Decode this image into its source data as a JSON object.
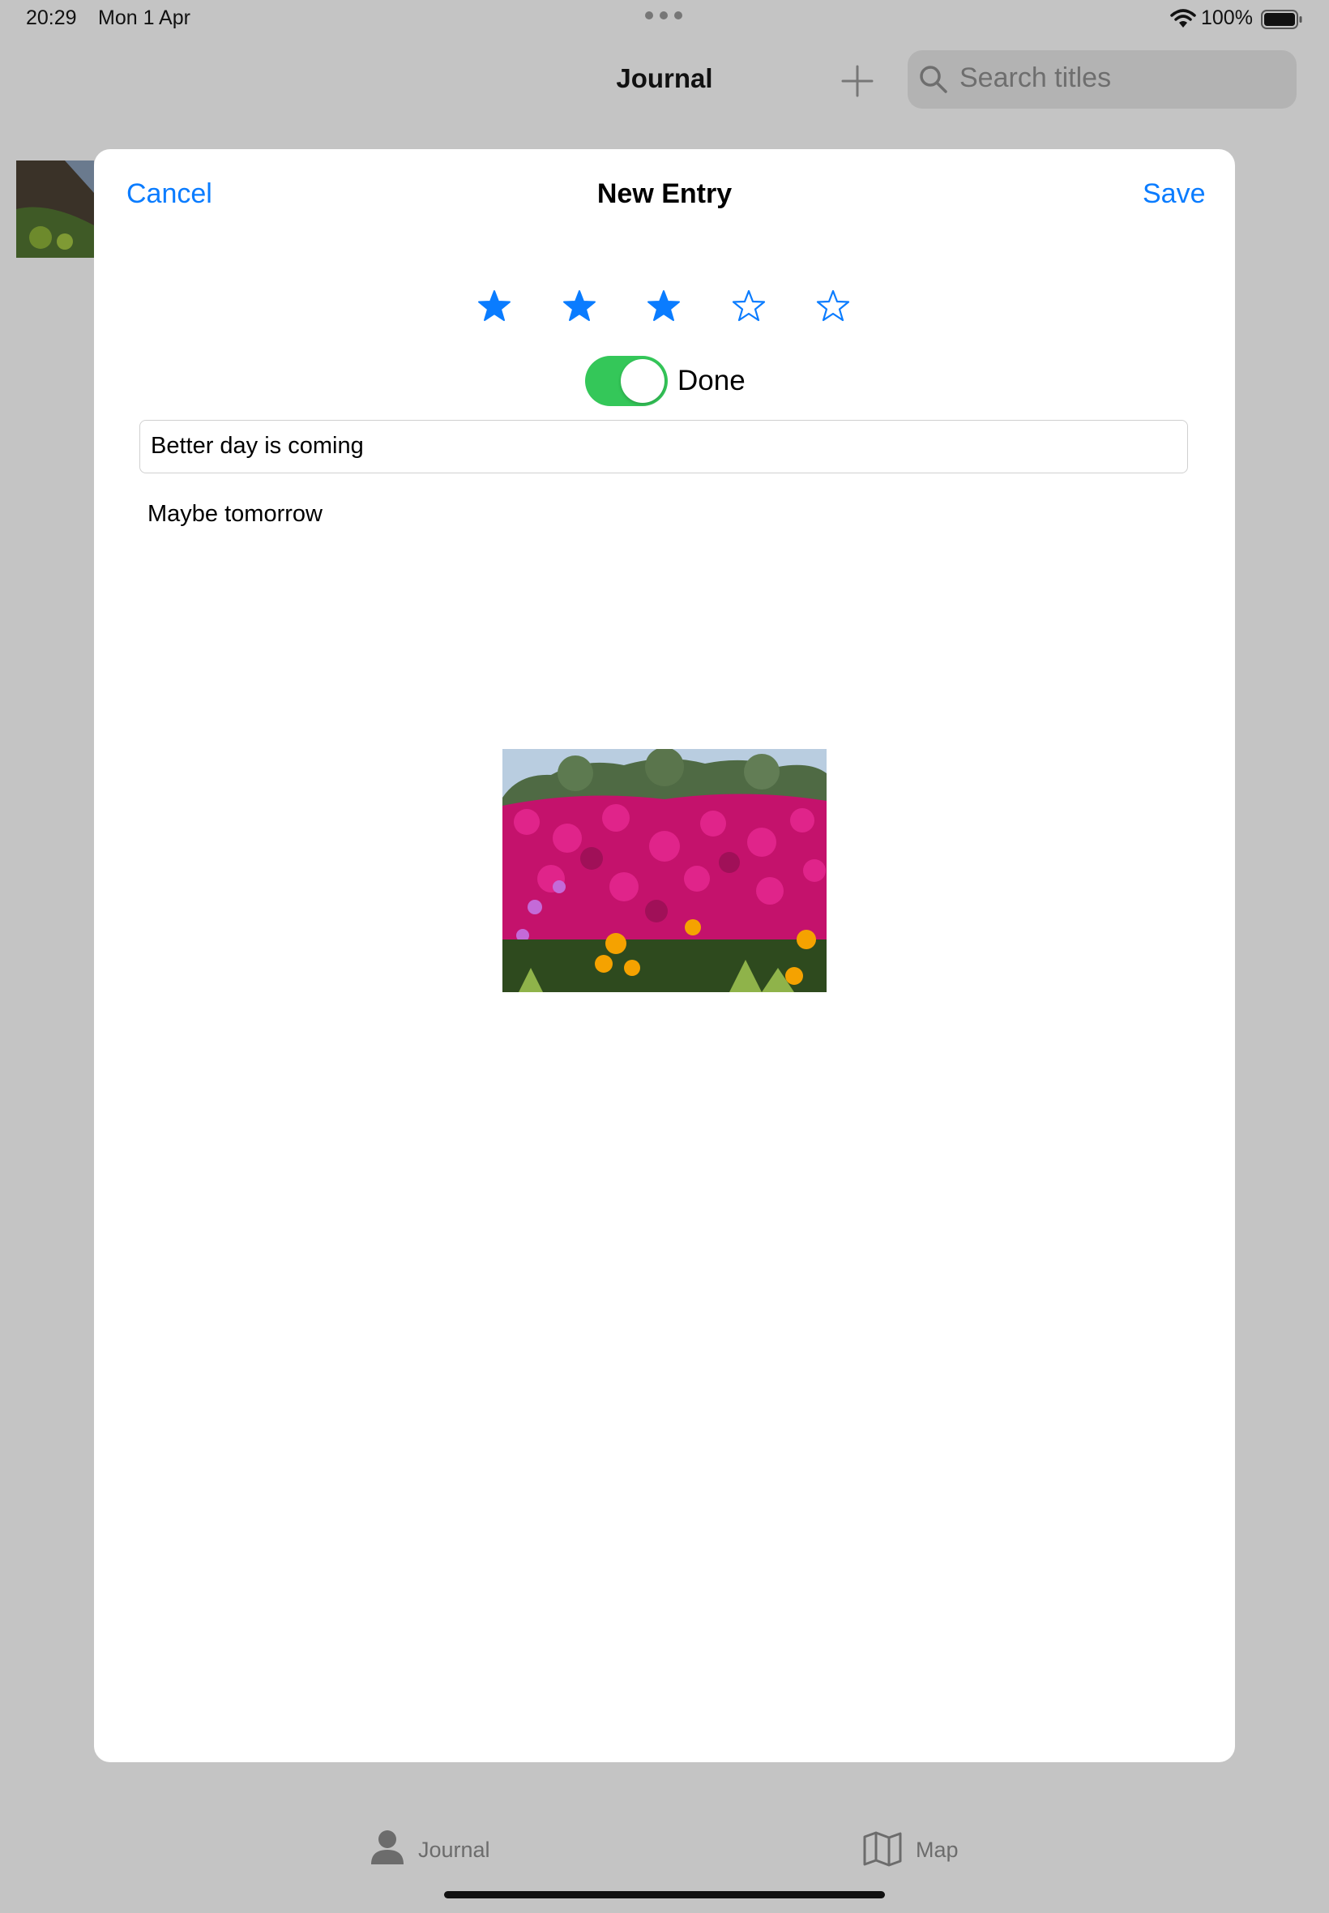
{
  "status_bar": {
    "time": "20:29",
    "date": "Mon 1 Apr",
    "battery": "100%"
  },
  "background": {
    "nav_title": "Journal",
    "search_placeholder": "Search titles"
  },
  "sheet": {
    "cancel_label": "Cancel",
    "title": "New Entry",
    "save_label": "Save",
    "rating": {
      "value": 3,
      "max": 5
    },
    "done_toggle": {
      "label": "Done",
      "on": true
    },
    "title_field_value": "Better day is coming",
    "body_text": "Maybe tomorrow"
  },
  "tab_bar": {
    "items": [
      {
        "label": "Journal",
        "icon": "person-icon"
      },
      {
        "label": "Map",
        "icon": "map-icon"
      }
    ]
  },
  "colors": {
    "accent": "#0a7cff",
    "toggle_on": "#34c759",
    "dim_background": "#c4c4c4"
  }
}
